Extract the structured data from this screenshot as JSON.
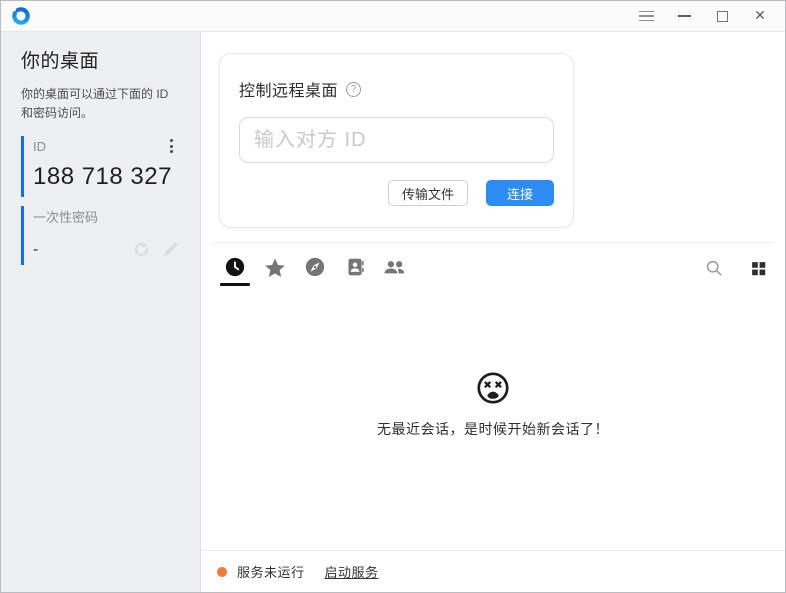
{
  "window": {
    "logo_icon": "rustdesk-logo",
    "controls": {
      "menu": "menu-icon",
      "minimize": "minimize-icon",
      "maximize": "maximize-icon",
      "close": "close-icon"
    }
  },
  "sidebar": {
    "title": "你的桌面",
    "description": "你的桌面可以通过下面的 ID 和密码访问。",
    "id_section": {
      "label": "ID",
      "value": "188 718 327",
      "menu_icon": "vertical-dots-icon"
    },
    "password_section": {
      "label": "一次性密码",
      "value": "-",
      "icons": [
        "refresh-icon",
        "pencil-icon"
      ]
    }
  },
  "main": {
    "card": {
      "title": "控制远程桌面",
      "help_icon_glyph": "?",
      "input_value": "",
      "input_placeholder": "输入对方 ID",
      "transfer_button": "传输文件",
      "connect_button": "连接"
    },
    "tabs": [
      {
        "id": "recent-sessions",
        "icon": "clock-icon",
        "active": true
      },
      {
        "id": "favorites",
        "icon": "star-icon",
        "active": false
      },
      {
        "id": "discovered",
        "icon": "compass-icon",
        "active": false
      },
      {
        "id": "address-book",
        "icon": "address-book-icon",
        "active": false
      },
      {
        "id": "group",
        "icon": "group-icon",
        "active": false
      }
    ],
    "toolbar_icons": [
      "search-icon",
      "grid-view-icon"
    ],
    "empty_state": {
      "icon": "dead-face-icon",
      "message": "无最近会话，是时候开始新会话了！"
    }
  },
  "status_bar": {
    "status_text": "服务未运行",
    "action_link": "启动服务"
  },
  "colors": {
    "accent_blue_bar": "#0B6FF7",
    "connect_button_blue": "#2C8CF4",
    "status_orange": "#F5793B",
    "sidebar_bg": "#EEEFF1",
    "tab_icon_gray": "#757575",
    "active_tab_black": "#111111"
  }
}
